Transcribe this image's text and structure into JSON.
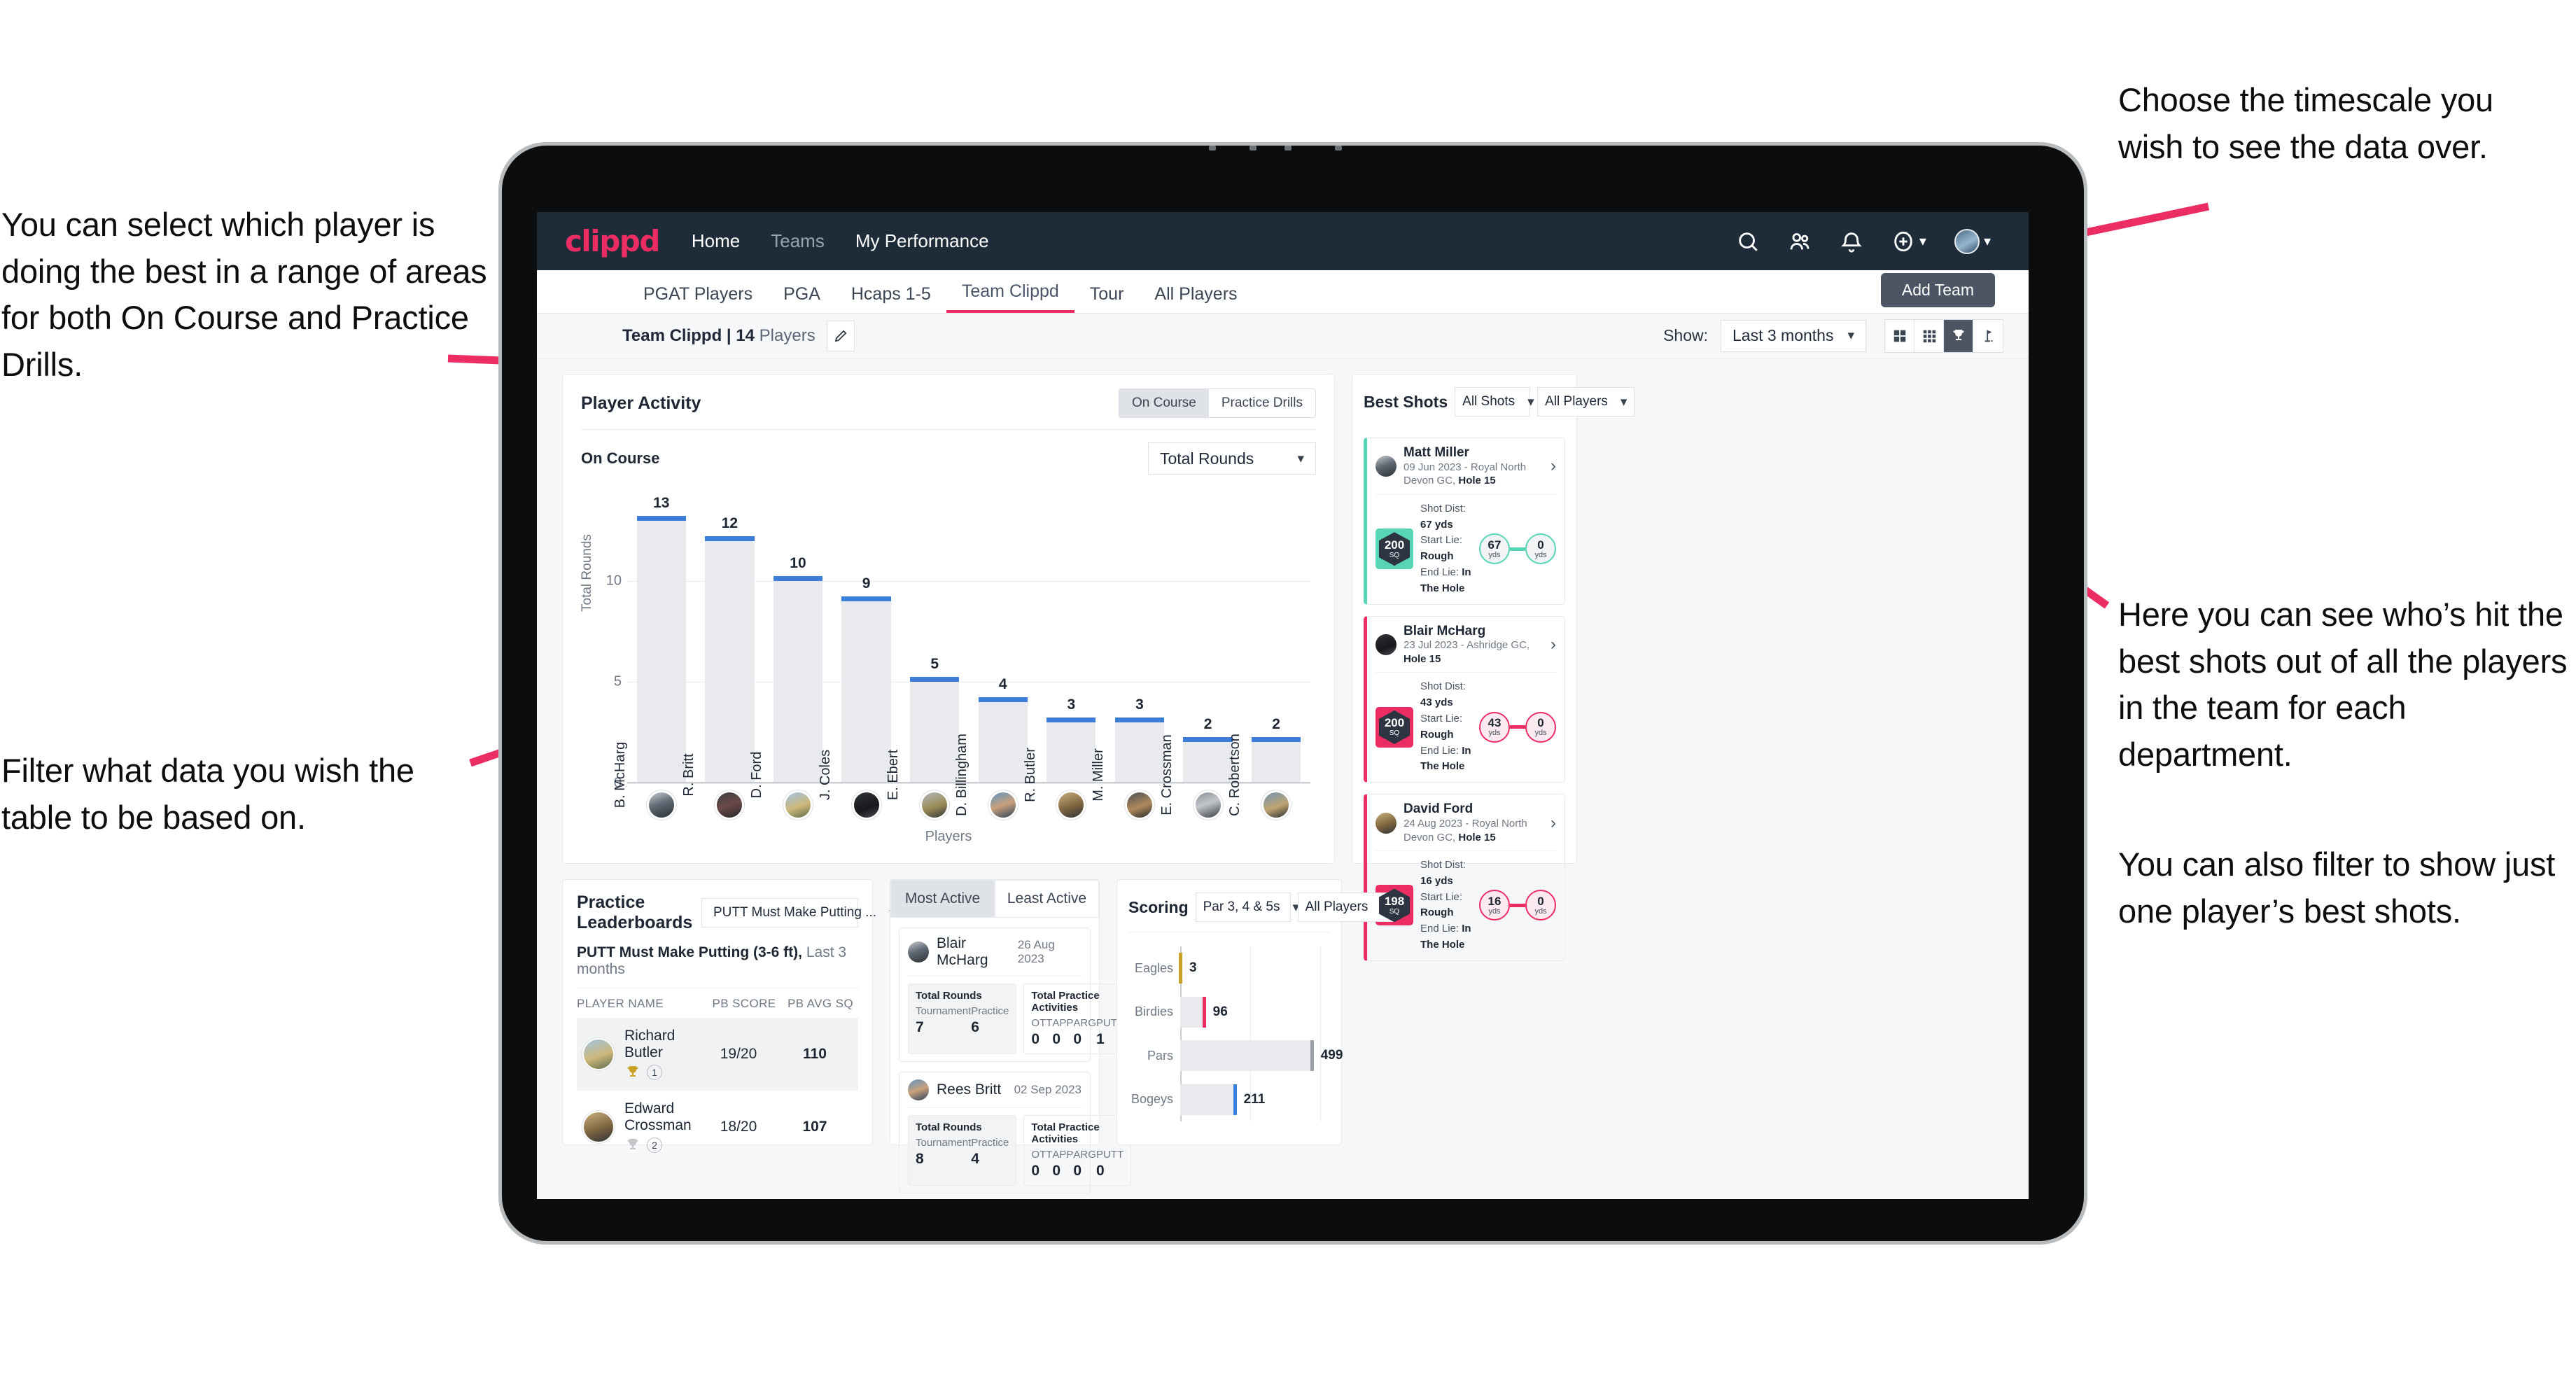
{
  "annotations": {
    "left_top": "You can select which player is doing the best in a range of areas for both On Course and Practice Drills.",
    "left_bottom": "Filter what data you wish the table to be based on.",
    "top_right": "Choose the timescale you wish to see the data over.",
    "right_1": "Here you can see who’s hit the best shots out of all the players in the team for each department.",
    "right_2": "You can also filter to show just one player’s best shots."
  },
  "appbar": {
    "logo": "clippd",
    "links": [
      {
        "label": "Home",
        "dim": false
      },
      {
        "label": "Teams",
        "dim": true
      },
      {
        "label": "My Performance",
        "dim": false
      }
    ],
    "icons": [
      "search-icon",
      "people-icon",
      "bell-icon",
      "plus-circle-icon",
      "avatar-icon"
    ]
  },
  "tabs": [
    {
      "label": "PGAT Players",
      "active": false
    },
    {
      "label": "PGA",
      "active": false
    },
    {
      "label": "Hcaps 1-5",
      "active": false
    },
    {
      "label": "Team Clippd",
      "active": true
    },
    {
      "label": "Tour",
      "active": false
    },
    {
      "label": "All Players",
      "active": false
    }
  ],
  "add_team_button": "Add Team",
  "subbar": {
    "team_name": "Team Clippd",
    "separator": " | ",
    "player_count": "14",
    "players_word": " Players",
    "edit_icon": "pencil-icon",
    "show_label": "Show:",
    "show_value": "Last 3 months",
    "view_buttons": [
      {
        "name": "grid-4-icon",
        "active": false
      },
      {
        "name": "grid-9-icon",
        "active": false
      },
      {
        "name": "trophy-icon",
        "active": true
      },
      {
        "name": "flag-icon",
        "active": false
      }
    ]
  },
  "player_activity": {
    "title": "Player Activity",
    "segments": [
      {
        "label": "On Course",
        "active": true
      },
      {
        "label": "Practice Drills",
        "active": false
      }
    ],
    "sub_title": "On Course",
    "metric_select": "Total Rounds"
  },
  "chart_data": {
    "type": "bar",
    "title": "Player Activity — On Course",
    "xlabel": "Players",
    "ylabel": "Total Rounds",
    "ylim": [
      0,
      14
    ],
    "yticks": [
      0,
      5,
      10
    ],
    "grid": true,
    "categories": [
      "B. McHarg",
      "R. Britt",
      "D. Ford",
      "J. Coles",
      "E. Ebert",
      "D. Billingham",
      "R. Butler",
      "M. Miller",
      "E. Crossman",
      "C. Robertson"
    ],
    "values": [
      13,
      12,
      10,
      9,
      5,
      4,
      3,
      3,
      2,
      2
    ],
    "bar_color": "#e8eaed",
    "cap_color": "#3b7dd8"
  },
  "best_shots": {
    "title": "Best Shots",
    "shot_filter": "All Shots",
    "player_filter": "All Players",
    "items": [
      {
        "name": "Matt Miller",
        "meta_date": "09 Jun 2023 - Royal North Devon GC, ",
        "meta_hole": "Hole 15",
        "sq": "200",
        "sq_unit": "SQ",
        "accent": "#58d5b5",
        "shot_dist_label": "Shot Dist: ",
        "shot_dist": "67 yds",
        "start_lie_label": "Start Lie: ",
        "start_lie": "Rough",
        "end_lie_label": "End Lie: ",
        "end_lie": "In The Hole",
        "from_value": "67",
        "from_unit": "yds",
        "to_value": "0",
        "to_unit": "yds"
      },
      {
        "name": "Blair McHarg",
        "meta_date": "23 Jul 2023 - Ashridge GC, ",
        "meta_hole": "Hole 15",
        "sq": "200",
        "sq_unit": "SQ",
        "accent": "#ec2d63",
        "shot_dist_label": "Shot Dist: ",
        "shot_dist": "43 yds",
        "start_lie_label": "Start Lie: ",
        "start_lie": "Rough",
        "end_lie_label": "End Lie: ",
        "end_lie": "In The Hole",
        "from_value": "43",
        "from_unit": "yds",
        "to_value": "0",
        "to_unit": "yds"
      },
      {
        "name": "David Ford",
        "meta_date": "24 Aug 2023 - Royal North Devon GC, ",
        "meta_hole": "Hole 15",
        "sq": "198",
        "sq_unit": "SQ",
        "accent": "#ec2d63",
        "shot_dist_label": "Shot Dist: ",
        "shot_dist": "16 yds",
        "start_lie_label": "Start Lie: ",
        "start_lie": "Rough",
        "end_lie_label": "End Lie: ",
        "end_lie": "In The Hole",
        "from_value": "16",
        "from_unit": "yds",
        "to_value": "0",
        "to_unit": "yds"
      }
    ]
  },
  "practice_leaderboards": {
    "title": "Practice Leaderboards",
    "drill_select": "PUTT Must Make Putting ...",
    "sub_bold": "PUTT Must Make Putting (3-6 ft),",
    "sub_light": " Last 3 months",
    "columns": [
      "PLAYER NAME",
      "PB SCORE",
      "PB AVG SQ"
    ],
    "rows": [
      {
        "name": "Richard Butler",
        "rank": "1",
        "trophy": "gold",
        "pb_score": "19/20",
        "pb_avg_sq": "110",
        "highlight": true
      },
      {
        "name": "Edward Crossman",
        "rank": "2",
        "trophy": "silver",
        "pb_score": "18/20",
        "pb_avg_sq": "107",
        "highlight": false
      }
    ]
  },
  "activity_panel": {
    "tabs": [
      {
        "label": "Most Active",
        "active": true
      },
      {
        "label": "Least Active",
        "active": false
      }
    ],
    "cards": [
      {
        "name": "Blair McHarg",
        "date": "26 Aug 2023",
        "rounds_title": "Total Rounds",
        "tournament_label": "Tournament",
        "tournament_value": "7",
        "practice_label": "Practice",
        "practice_value": "6",
        "practice_title": "Total Practice Activities",
        "cats": [
          "OTT",
          "APP",
          "ARG",
          "PUTT"
        ],
        "cat_values": [
          "0",
          "0",
          "0",
          "1"
        ]
      },
      {
        "name": "Rees Britt",
        "date": "02 Sep 2023",
        "rounds_title": "Total Rounds",
        "tournament_label": "Tournament",
        "tournament_value": "8",
        "practice_label": "Practice",
        "practice_value": "4",
        "practice_title": "Total Practice Activities",
        "cats": [
          "OTT",
          "APP",
          "ARG",
          "PUTT"
        ],
        "cat_values": [
          "0",
          "0",
          "0",
          "0"
        ]
      }
    ]
  },
  "scoring": {
    "title": "Scoring",
    "par_filter": "Par 3, 4 & 5s",
    "player_filter": "All Players"
  },
  "scoring_chart": {
    "type": "bar",
    "orientation": "horizontal",
    "title": "Scoring",
    "categories": [
      "Eagles",
      "Birdies",
      "Pars",
      "Bogeys"
    ],
    "values": [
      3,
      96,
      499,
      211
    ],
    "colors": [
      "#c9a227",
      "#ec2d63",
      "#9aa0a6",
      "#3b7dd8"
    ],
    "xlim": [
      0,
      560
    ],
    "grid": true
  }
}
